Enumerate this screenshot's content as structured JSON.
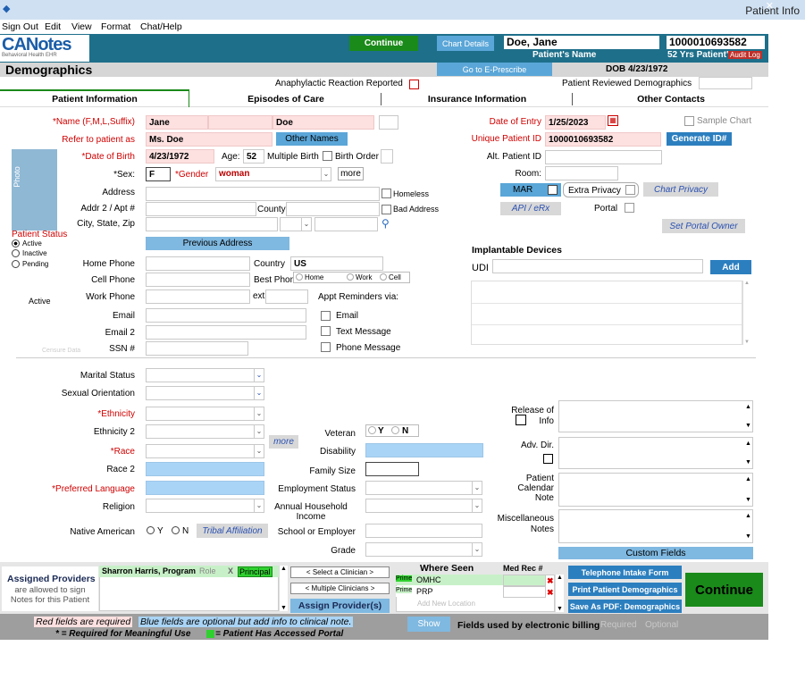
{
  "window": {
    "title": "Patient Info"
  },
  "menu": [
    "Sign Out",
    "Edit",
    "View",
    "Format",
    "Chat/Help"
  ],
  "logo": {
    "text": "CANotes",
    "sub": "Behavioral Health EHR"
  },
  "header": {
    "continue_label": "Continue",
    "chart_details_label": "Chart Details",
    "patient_name": "Doe, Jane",
    "patient_name_caption": "Patient's Name",
    "patient_id": "1000010693582",
    "patient_id_caption": "52 Yrs Patient's ID",
    "audit_log_label": "Audit Log",
    "page_title": "Demographics",
    "eprescribe_label": "Go to E-Prescribe",
    "dob_text": "DOB 4/23/1972",
    "anaphylactic_label": "Anaphylactic Reaction Reported",
    "reviewed_label": "Patient Reviewed Demographics"
  },
  "tabs": [
    "Patient Information",
    "Episodes of Care",
    "Insurance Information",
    "Other Contacts"
  ],
  "form": {
    "name_label": "*Name (F,M,L,Suffix)",
    "first_name": "Jane",
    "last_name": "Doe",
    "refer_label": "Refer to patient as",
    "refer_value": "Ms. Doe",
    "other_names_label": "Other Names",
    "dob_label": "*Date of Birth",
    "dob_value": "4/23/1972",
    "age_label": "Age:",
    "age_value": "52",
    "multiple_birth_label": "Multiple Birth",
    "birth_order_label": "Birth Order",
    "sex_label": "*Sex:",
    "sex_value": "F",
    "gender_label": "*Gender",
    "gender_value": "woman",
    "more_label": "more",
    "address_label": "Address",
    "homeless_label": "Homeless",
    "addr2_label": "Addr 2 / Apt #",
    "county_label": "County",
    "bad_address_label": "Bad Address",
    "city_label": "City, State, Zip",
    "previous_address_label": "Previous Address",
    "home_phone_label": "Home Phone",
    "country_label": "Country",
    "country_value": "US",
    "cell_phone_label": "Cell Phone",
    "best_phone_label": "Best Phone",
    "best_phone_options": [
      "Home",
      "Work",
      "Cell"
    ],
    "work_phone_label": "Work Phone",
    "ext_label": "ext",
    "appt_reminders_label": "Appt Reminders via:",
    "email_label": "Email",
    "email2_label": "Email 2",
    "ssn_label": "SSN #",
    "remind_email": "Email",
    "remind_text": "Text Message",
    "remind_phone": "Phone Message",
    "photo_label": "Photo",
    "censor_label": "Censure Data",
    "patient_status_label": "Patient Status",
    "status_options": [
      "Active",
      "Inactive",
      "Pending"
    ],
    "status_text": "Active",
    "date_entry_label": "Date of Entry",
    "date_entry_value": "1/25/2023",
    "sample_chart_label": "Sample Chart",
    "unique_id_label": "Unique Patient ID",
    "unique_id_value": "1000010693582",
    "generate_id_label": "Generate ID#",
    "alt_id_label": "Alt. Patient ID",
    "room_label": "Room:",
    "mar_label": "MAR",
    "extra_privacy_label": "Extra Privacy",
    "chart_privacy_label": "Chart Privacy",
    "api_label": "API / eRx",
    "portal_label": "Portal",
    "set_portal_label": "Set Portal Owner",
    "implantable_label": "Implantable Devices",
    "udi_label": "UDI",
    "add_label": "Add",
    "marital_label": "Marital Status",
    "sexual_orientation_label": "Sexual Orientation",
    "ethnicity_label": "*Ethnicity",
    "ethnicity2_label": "Ethnicity 2",
    "race_label": "*Race",
    "race2_label": "Race 2",
    "language_label": "*Preferred Language",
    "religion_label": "Religion",
    "native_label": "Native American",
    "yes_label": "Y",
    "no_label": "N",
    "tribal_label": "Tribal Affiliation",
    "race_more_label": "more",
    "veteran_label": "Veteran",
    "disability_label": "Disability",
    "family_size_label": "Family Size",
    "employment_label": "Employment Status",
    "income_label": "Annual Household Income",
    "school_label": "School or Employer",
    "grade_label": "Grade",
    "release_label": "Release of Info",
    "adv_dir_label": "Adv. Dir.",
    "calendar_note_label": "Patient Calendar Note",
    "misc_notes_label": "Miscellaneous Notes",
    "custom_fields_label": "Custom Fields"
  },
  "providers": {
    "title": "Assigned Providers",
    "subtitle": "are allowed to sign Notes for this Patient",
    "provider_name": "Sharron Harris, Program",
    "role_label": "Role",
    "x_label": "X",
    "principal_label": "Principal",
    "select_clinician": "< Select a Clinician >",
    "multiple_clinicians": "< Multiple Clinicians >",
    "assign_label": "Assign Provider(s)"
  },
  "where_seen": {
    "title": "Where Seen",
    "med_rec_label": "Med Rec #",
    "prime_label": "Prime",
    "locations": [
      "OMHC",
      "PRP"
    ],
    "add_placeholder": "Add New Location"
  },
  "actions": {
    "phone_intake": "Telephone Intake Form",
    "print_demo": "Print Patient Demographics",
    "save_pdf": "Save As PDF: Demographics",
    "continue_big": "Continue"
  },
  "footer": {
    "red_note": "Red fields are required",
    "blue_note": "Blue fields are optional but add info to clinical note.",
    "mu_note": "* = Required for Meaningful Use",
    "portal_note": "= Patient Has Accessed Portal",
    "show_label": "Show",
    "billing_label": "Fields used by electronic billing",
    "required_label": "Required",
    "optional_label": "Optional"
  },
  "colors": {
    "accent_green": "#1a8a1a",
    "header_teal": "#1e6f8a",
    "field_blue": "#a9d4f5",
    "field_pink": "#fde0e0"
  }
}
